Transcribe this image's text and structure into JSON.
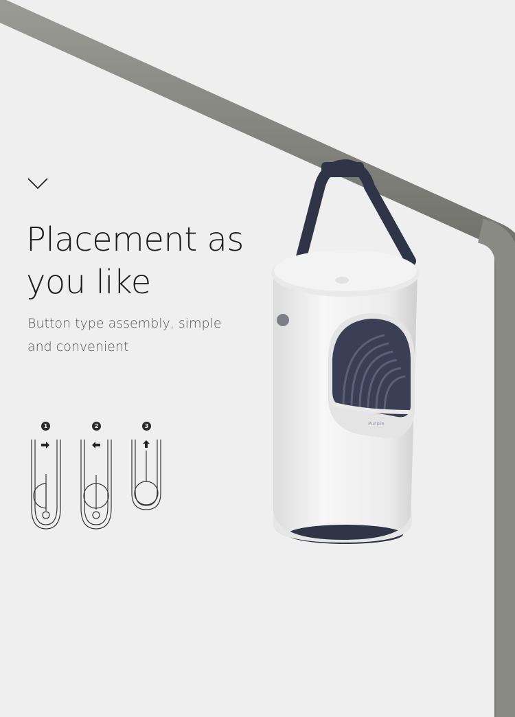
{
  "headline": {
    "line1": "Placement as",
    "line2": "you like"
  },
  "subheading": {
    "line1": "Button type assembly, simple",
    "line2": "and convenient"
  },
  "steps": [
    {
      "number": "1",
      "arrow": "arrow-right-icon"
    },
    {
      "number": "2",
      "arrow": "arrow-left-icon"
    },
    {
      "number": "3",
      "arrow": "arrow-up-icon"
    }
  ],
  "product": {
    "brand": "Purple"
  },
  "colors": {
    "background": "#efefef",
    "pole": "#8a8a84",
    "strap": "#2f3446",
    "body": "#f4f4f4",
    "text": "#1d1d1d"
  }
}
